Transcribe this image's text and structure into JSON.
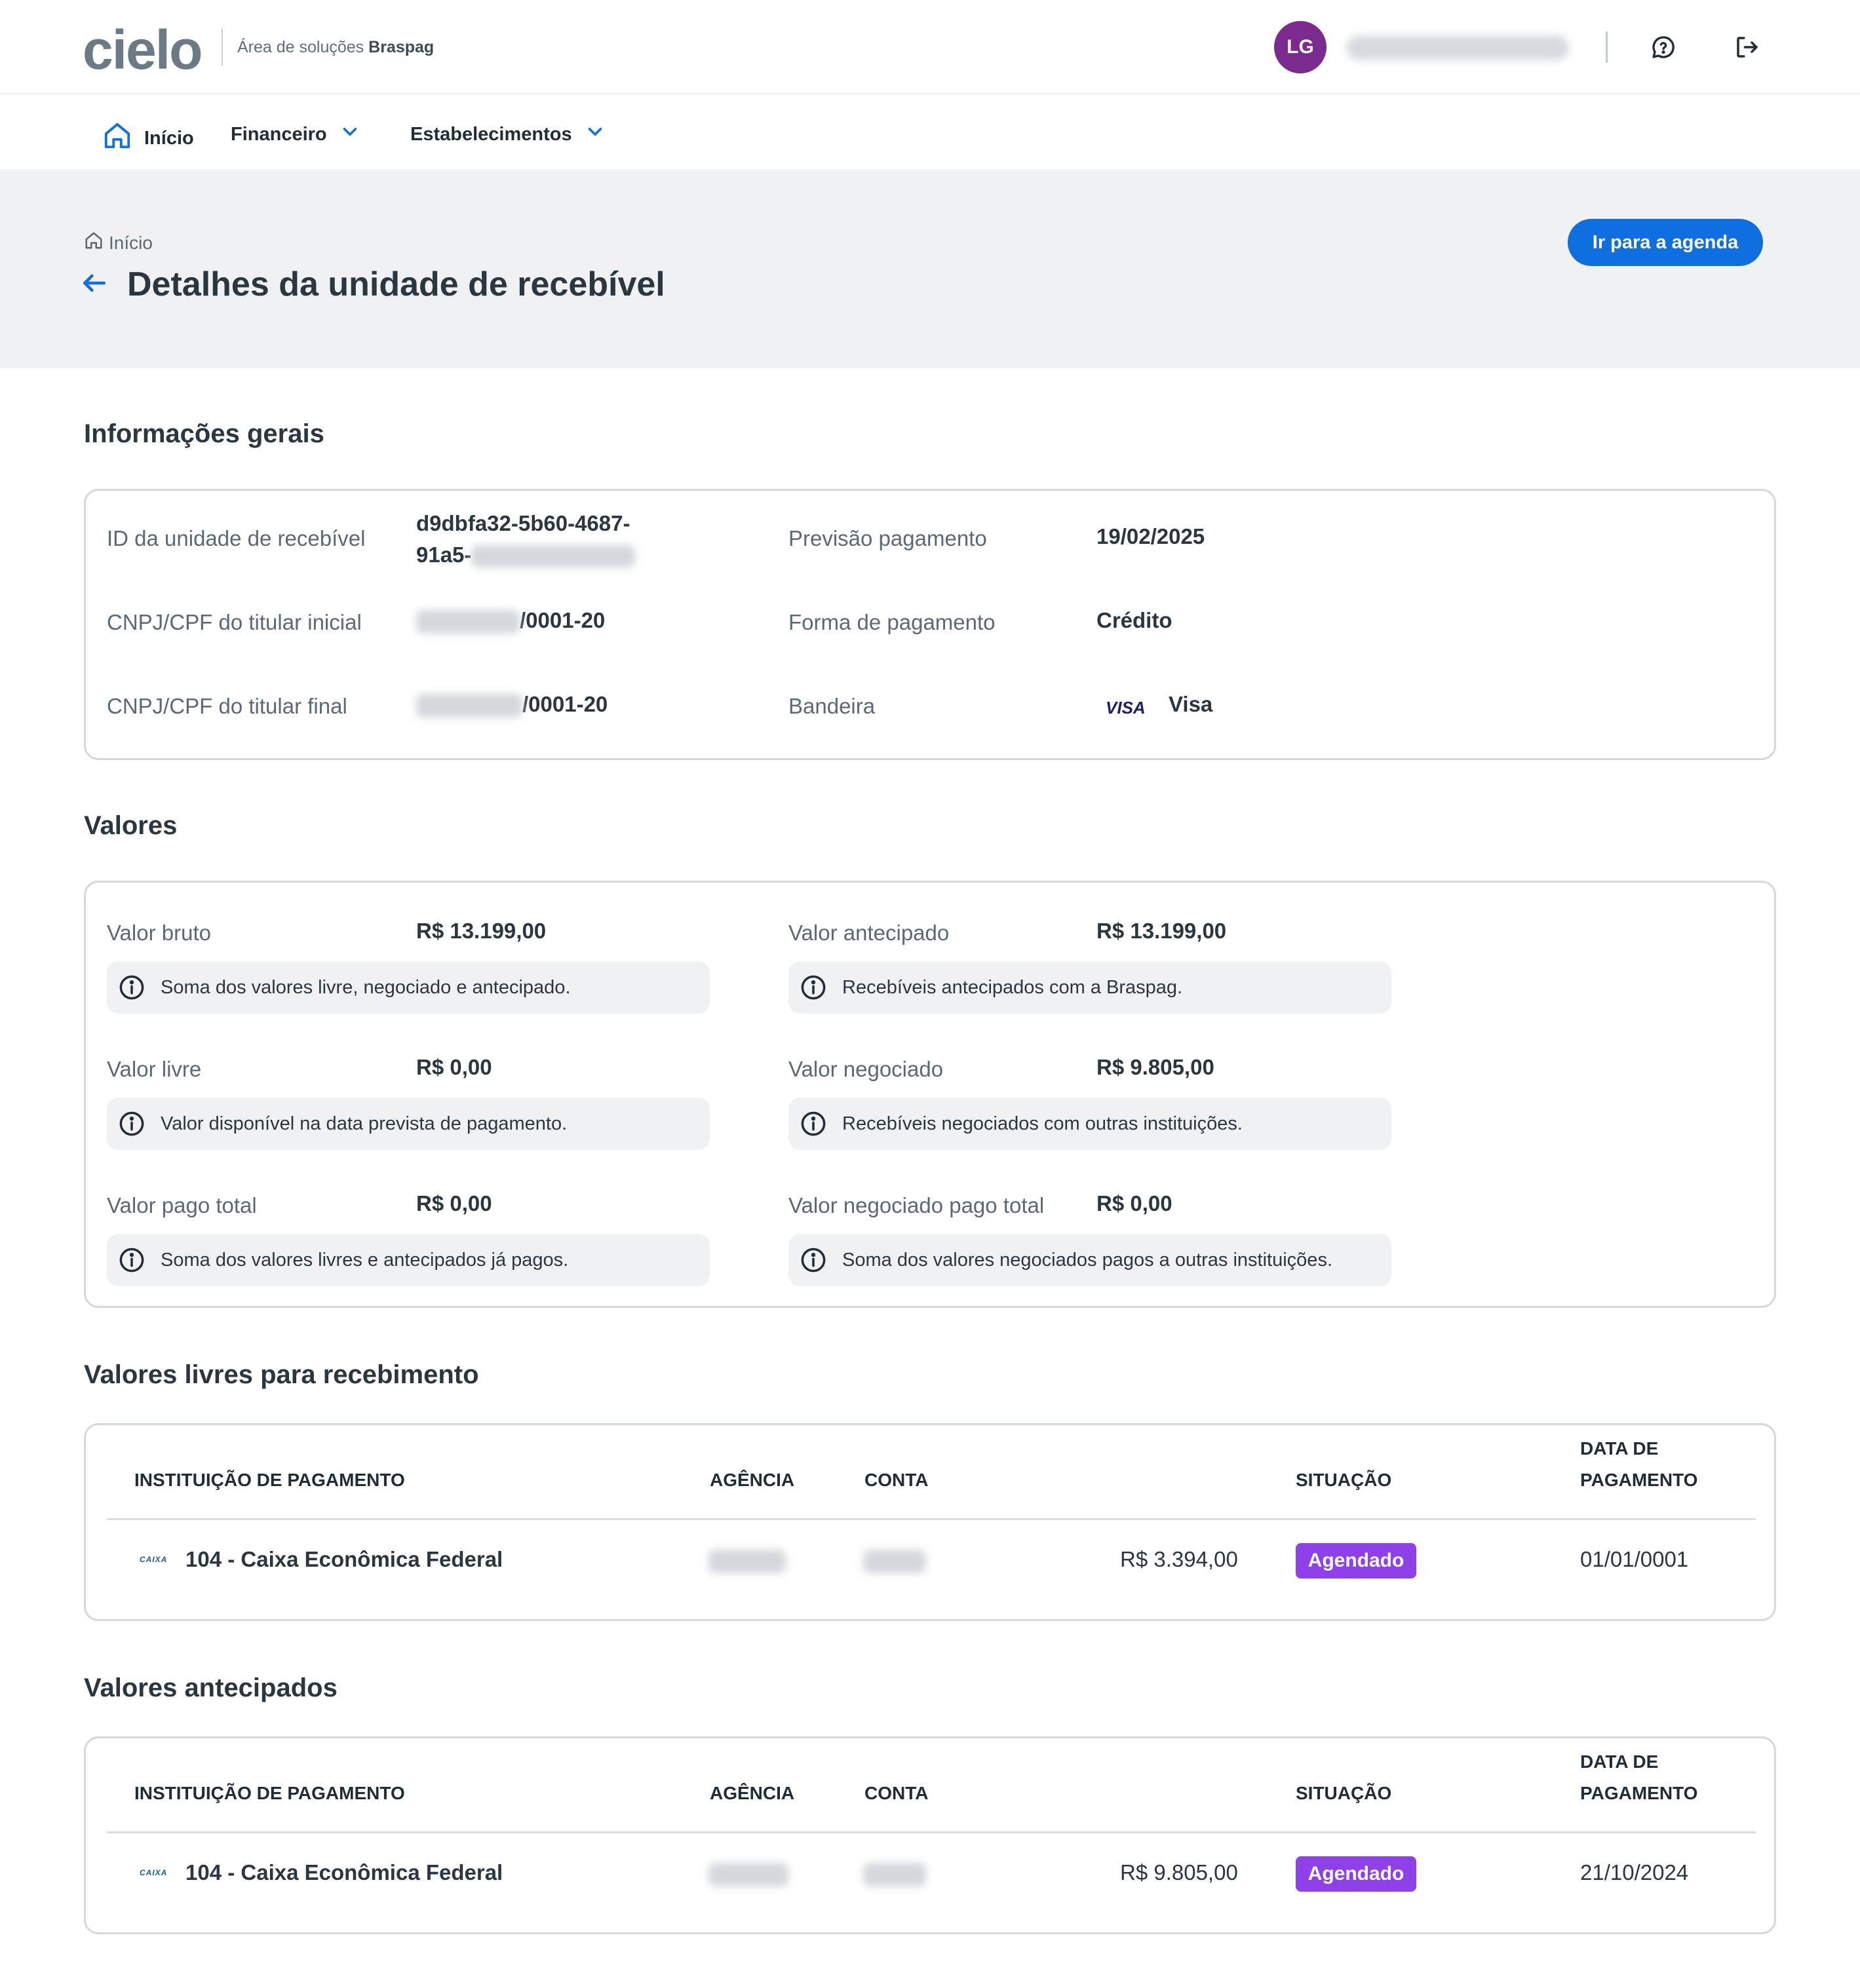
{
  "header": {
    "logo_text": "cielo",
    "logo_subtitle": "Área de soluções",
    "logo_subtitle_brand": "Braspag",
    "avatar_initials": "LG"
  },
  "nav": {
    "home": "Início",
    "financeiro": "Financeiro",
    "estabelecimentos": "Estabelecimentos"
  },
  "page": {
    "breadcrumb": "Início",
    "title": "Detalhes da unidade de recebível",
    "agenda_button": "Ir para a agenda"
  },
  "general": {
    "section_title": "Informações gerais",
    "id_label": "ID da unidade de recebível",
    "id_value_line1": "d9dbfa32-5b60-4687-",
    "id_value_line2": "91a5-",
    "cnpj_initial_label": "CNPJ/CPF do titular inicial",
    "cnpj_initial_suffix": "/0001-20",
    "cnpj_final_label": "CNPJ/CPF do titular final",
    "cnpj_final_suffix": "/0001-20",
    "forecast_label": "Previsão pagamento",
    "forecast_value": "19/02/2025",
    "payment_form_label": "Forma de pagamento",
    "payment_form_value": "Crédito",
    "brand_label": "Bandeira",
    "brand_logo": "VISA",
    "brand_value": "Visa"
  },
  "values": {
    "section_title": "Valores",
    "gross_label": "Valor bruto",
    "gross_value": "R$ 13.199,00",
    "gross_note": "Soma dos valores livre, negociado e antecipado.",
    "anticipated_label": "Valor antecipado",
    "anticipated_value": "R$ 13.199,00",
    "anticipated_note": "Recebíveis antecipados com a Braspag.",
    "free_label": "Valor livre",
    "free_value": "R$ 0,00",
    "free_note": "Valor disponível na data prevista de pagamento.",
    "negotiated_label": "Valor negociado",
    "negotiated_value": "R$ 9.805,00",
    "negotiated_note": "Recebíveis negociados com outras instituições.",
    "paid_total_label": "Valor pago total",
    "paid_total_value": "R$ 0,00",
    "paid_total_note": "Soma dos valores livres e antecipados já pagos.",
    "negotiated_paid_label": "Valor negociado pago total",
    "negotiated_paid_value": "R$ 0,00",
    "negotiated_paid_note": "Soma dos valores negociados pagos a outras instituições."
  },
  "table_headers": {
    "institution": "INSTITUIÇÃO DE PAGAMENTO",
    "agency": "AGÊNCIA",
    "account": "CONTA",
    "status": "SITUAÇÃO",
    "date_line1": "DATA DE",
    "date_line2": "PAGAMENTO"
  },
  "free_table": {
    "section_title": "Valores livres para recebimento",
    "bank_logo": "CAIXA",
    "institution": "104 - Caixa Econômica Federal",
    "amount": "R$ 3.394,00",
    "status": "Agendado",
    "date": "01/01/0001"
  },
  "anticipated_table": {
    "section_title": "Valores antecipados",
    "bank_logo": "CAIXA",
    "institution": "104 - Caixa Econômica Federal",
    "amount": "R$ 9.805,00",
    "status": "Agendado",
    "date": "21/10/2024"
  },
  "colors": {
    "primary": "#0f6fde",
    "badge": "#8e41e8",
    "avatar": "#7b2a8e",
    "logo_accent": "#1aa3e8"
  },
  "icons": [
    "home-icon",
    "chevron-down-icon",
    "help-chat-icon",
    "logout-icon",
    "back-arrow-icon",
    "info-icon"
  ]
}
